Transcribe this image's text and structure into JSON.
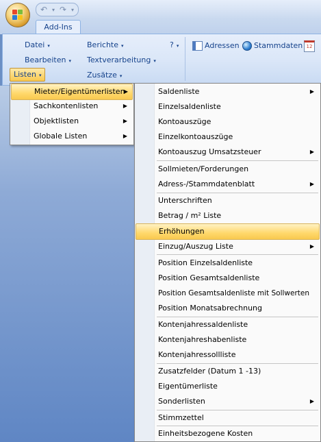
{
  "tab": {
    "label": "Add-Ins"
  },
  "ribbon": {
    "left_group": [
      {
        "label": "Datei",
        "arrow": "▾"
      },
      {
        "label": "Berichte",
        "arrow": "▾"
      },
      {
        "label": "?",
        "arrow": "▾"
      },
      {
        "label": "Bearbeiten",
        "arrow": "▾"
      },
      {
        "label": "Textverarbeitung",
        "arrow": "▾"
      },
      {
        "label": "Listen",
        "arrow": "▾"
      },
      {
        "label": "Zusätze",
        "arrow": "▾"
      }
    ],
    "toolbar": [
      {
        "label": "Adressen",
        "icon": "address-book-icon"
      },
      {
        "label": "Stammdaten",
        "icon": "globe-icon"
      },
      {
        "label": "",
        "icon": "calendar-icon",
        "icon_text": "12"
      }
    ]
  },
  "menu1": {
    "items": [
      {
        "label": "Mieter/Eigentümerlisten",
        "submenu": true,
        "highlighted": true
      },
      {
        "label": "Sachkontenlisten",
        "submenu": true
      },
      {
        "label": "Objektlisten",
        "submenu": true
      },
      {
        "label": "Globale Listen",
        "submenu": true
      }
    ]
  },
  "menu2": {
    "items": [
      {
        "label": "Saldenliste",
        "submenu": true
      },
      {
        "label": "Einzelsaldenliste"
      },
      {
        "label": "Kontoauszüge"
      },
      {
        "label": "Einzelkontoauszüge"
      },
      {
        "label": "Kontoauszug Umsatzsteuer",
        "submenu": true
      },
      {
        "label": "Sollmieten/Forderungen"
      },
      {
        "label": "Adress-/Stammdatenblatt",
        "submenu": true
      },
      {
        "label": "Unterschriften"
      },
      {
        "label": "Betrag / m² Liste"
      },
      {
        "label": "Erhöhungen",
        "highlighted": true
      },
      {
        "label": "Einzug/Auszug Liste",
        "submenu": true
      },
      {
        "label": "Position Einzelsaldenliste"
      },
      {
        "label": "Position Gesamtsaldenliste"
      },
      {
        "label": "Position Gesamtsaldenliste mit Sollwerten"
      },
      {
        "label": "Position Monatsabrechnung"
      },
      {
        "label": "Kontenjahressaldenliste"
      },
      {
        "label": "Kontenjahreshabenliste"
      },
      {
        "label": "Kontenjahressollliste"
      },
      {
        "label": "Zusatzfelder (Datum 1 -13)"
      },
      {
        "label": "Eigentümerliste"
      },
      {
        "label": "Sonderlisten",
        "submenu": true
      },
      {
        "label": "Stimmzettel"
      },
      {
        "label": "Einheitsbezogene Kosten"
      }
    ]
  },
  "symbols": {
    "submenu_arrow": "▶",
    "undo": "↶",
    "redo": "↷",
    "dropdown": "▾"
  },
  "colors": {
    "highlight": "#f9c94f",
    "ribbon_text": "#15428b",
    "menu_border": "#868686"
  }
}
